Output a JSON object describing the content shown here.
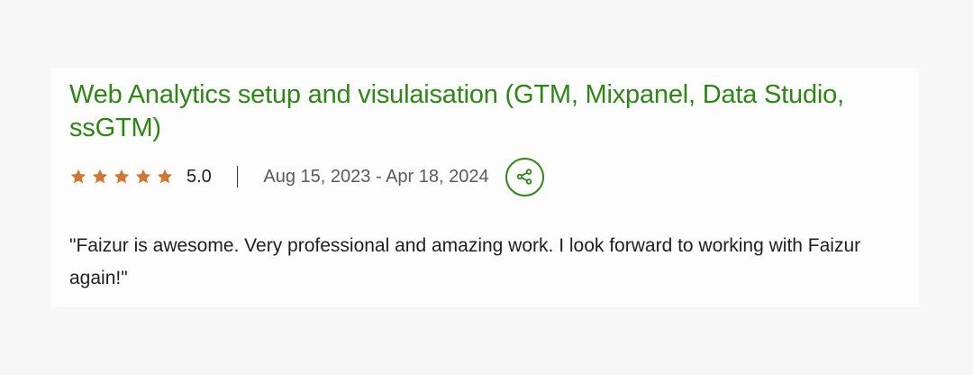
{
  "review": {
    "title": "Web Analytics setup and visulaisation (GTM, Mixpanel, Data Studio, ssGTM)",
    "rating": "5.0",
    "stars_filled": 5,
    "stars_total": 5,
    "date_range": "Aug 15, 2023 - Apr 18, 2024",
    "share_icon": "share-icon",
    "quote": "\"Faizur is awesome. Very professional and amazing work. I look forward to working with Faizur again!\""
  },
  "colors": {
    "title": "#2f8516",
    "star": "#d07832",
    "share_border": "#2f8516",
    "text": "#1f1f1f",
    "muted": "#5a5a5a"
  }
}
